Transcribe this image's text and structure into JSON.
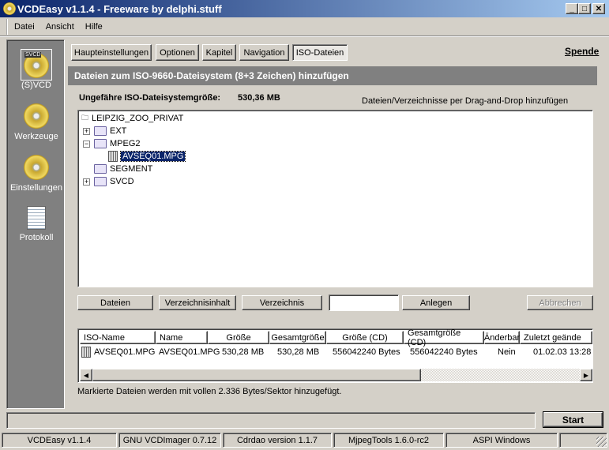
{
  "window": {
    "title": "VCDEasy v1.1.4 - Freeware by delphi.stuff"
  },
  "menu": [
    "Datei",
    "Ansicht",
    "Hilfe"
  ],
  "sidebar": [
    {
      "label": "(S)VCD",
      "icon": "svcd-disc-icon"
    },
    {
      "label": "Werkzeuge",
      "icon": "tools-disc-icon"
    },
    {
      "label": "Einstellungen",
      "icon": "settings-disc-icon"
    },
    {
      "label": "Protokoll",
      "icon": "log-document-icon"
    }
  ],
  "tabs": [
    "Haupteinstellungen",
    "Optionen",
    "Kapitel",
    "Navigation",
    "ISO-Dateien"
  ],
  "active_tab": "ISO-Dateien",
  "donate": "Spende",
  "header": "Dateien zum ISO-9660-Dateisystem (8+3 Zeichen) hinzufügen",
  "size_label": "Ungefähre ISO-Dateisystemgröße:",
  "size_value": "530,36 MB",
  "dragdrop_hint": "Dateien/Verzeichnisse per Drag-and-Drop hinzufügen",
  "tree": {
    "root": "LEIPZIG_ZOO_PRIVAT",
    "items": [
      "EXT",
      "MPEG2",
      "AVSEQ01.MPG",
      "SEGMENT",
      "SVCD"
    ]
  },
  "buttons": {
    "files": "Dateien",
    "dir_content": "Verzeichnisinhalt",
    "directory": "Verzeichnis",
    "add": "Anlegen",
    "cancel": "Abbrechen",
    "start": "Start"
  },
  "new_name_input": "",
  "list": {
    "columns": [
      "ISO-Name",
      "Name",
      "Größe",
      "Gesamtgröße",
      "Größe (CD)",
      "Gesamtgröße (CD)",
      "Änderbar",
      "Zuletzt geände"
    ],
    "rows": [
      [
        "AVSEQ01.MPG",
        "AVSEQ01.MPG",
        "530,28 MB",
        "530,28 MB",
        "556042240 Bytes",
        "556042240 Bytes",
        "Nein",
        "01.02.03 13:28"
      ]
    ]
  },
  "note": "Markierte Dateien werden mit vollen 2.336 Bytes/Sektor hinzugefügt.",
  "statusbar": [
    "VCDEasy v1.1.4",
    "GNU VCDImager 0.7.12",
    "Cdrdao version 1.1.7",
    "MjpegTools 1.6.0-rc2",
    "ASPI Windows",
    ""
  ]
}
